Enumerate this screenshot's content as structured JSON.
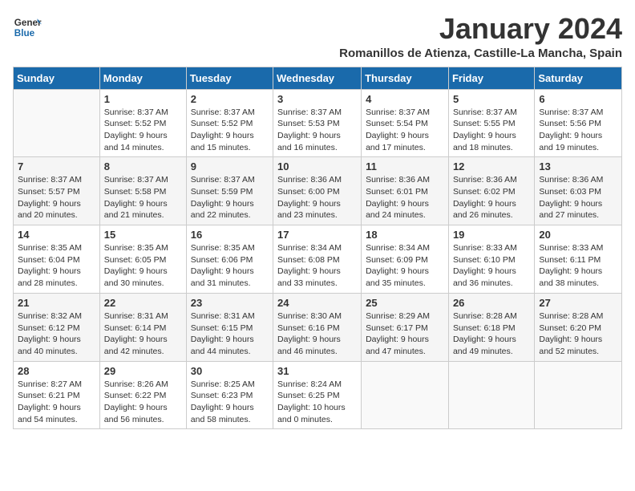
{
  "header": {
    "logo_general": "General",
    "logo_blue": "Blue",
    "month_title": "January 2024",
    "subtitle": "Romanillos de Atienza, Castille-La Mancha, Spain"
  },
  "days_of_week": [
    "Sunday",
    "Monday",
    "Tuesday",
    "Wednesday",
    "Thursday",
    "Friday",
    "Saturday"
  ],
  "weeks": [
    [
      {
        "num": "",
        "info": ""
      },
      {
        "num": "1",
        "info": "Sunrise: 8:37 AM\nSunset: 5:52 PM\nDaylight: 9 hours\nand 14 minutes."
      },
      {
        "num": "2",
        "info": "Sunrise: 8:37 AM\nSunset: 5:52 PM\nDaylight: 9 hours\nand 15 minutes."
      },
      {
        "num": "3",
        "info": "Sunrise: 8:37 AM\nSunset: 5:53 PM\nDaylight: 9 hours\nand 16 minutes."
      },
      {
        "num": "4",
        "info": "Sunrise: 8:37 AM\nSunset: 5:54 PM\nDaylight: 9 hours\nand 17 minutes."
      },
      {
        "num": "5",
        "info": "Sunrise: 8:37 AM\nSunset: 5:55 PM\nDaylight: 9 hours\nand 18 minutes."
      },
      {
        "num": "6",
        "info": "Sunrise: 8:37 AM\nSunset: 5:56 PM\nDaylight: 9 hours\nand 19 minutes."
      }
    ],
    [
      {
        "num": "7",
        "info": "Sunrise: 8:37 AM\nSunset: 5:57 PM\nDaylight: 9 hours\nand 20 minutes."
      },
      {
        "num": "8",
        "info": "Sunrise: 8:37 AM\nSunset: 5:58 PM\nDaylight: 9 hours\nand 21 minutes."
      },
      {
        "num": "9",
        "info": "Sunrise: 8:37 AM\nSunset: 5:59 PM\nDaylight: 9 hours\nand 22 minutes."
      },
      {
        "num": "10",
        "info": "Sunrise: 8:36 AM\nSunset: 6:00 PM\nDaylight: 9 hours\nand 23 minutes."
      },
      {
        "num": "11",
        "info": "Sunrise: 8:36 AM\nSunset: 6:01 PM\nDaylight: 9 hours\nand 24 minutes."
      },
      {
        "num": "12",
        "info": "Sunrise: 8:36 AM\nSunset: 6:02 PM\nDaylight: 9 hours\nand 26 minutes."
      },
      {
        "num": "13",
        "info": "Sunrise: 8:36 AM\nSunset: 6:03 PM\nDaylight: 9 hours\nand 27 minutes."
      }
    ],
    [
      {
        "num": "14",
        "info": "Sunrise: 8:35 AM\nSunset: 6:04 PM\nDaylight: 9 hours\nand 28 minutes."
      },
      {
        "num": "15",
        "info": "Sunrise: 8:35 AM\nSunset: 6:05 PM\nDaylight: 9 hours\nand 30 minutes."
      },
      {
        "num": "16",
        "info": "Sunrise: 8:35 AM\nSunset: 6:06 PM\nDaylight: 9 hours\nand 31 minutes."
      },
      {
        "num": "17",
        "info": "Sunrise: 8:34 AM\nSunset: 6:08 PM\nDaylight: 9 hours\nand 33 minutes."
      },
      {
        "num": "18",
        "info": "Sunrise: 8:34 AM\nSunset: 6:09 PM\nDaylight: 9 hours\nand 35 minutes."
      },
      {
        "num": "19",
        "info": "Sunrise: 8:33 AM\nSunset: 6:10 PM\nDaylight: 9 hours\nand 36 minutes."
      },
      {
        "num": "20",
        "info": "Sunrise: 8:33 AM\nSunset: 6:11 PM\nDaylight: 9 hours\nand 38 minutes."
      }
    ],
    [
      {
        "num": "21",
        "info": "Sunrise: 8:32 AM\nSunset: 6:12 PM\nDaylight: 9 hours\nand 40 minutes."
      },
      {
        "num": "22",
        "info": "Sunrise: 8:31 AM\nSunset: 6:14 PM\nDaylight: 9 hours\nand 42 minutes."
      },
      {
        "num": "23",
        "info": "Sunrise: 8:31 AM\nSunset: 6:15 PM\nDaylight: 9 hours\nand 44 minutes."
      },
      {
        "num": "24",
        "info": "Sunrise: 8:30 AM\nSunset: 6:16 PM\nDaylight: 9 hours\nand 46 minutes."
      },
      {
        "num": "25",
        "info": "Sunrise: 8:29 AM\nSunset: 6:17 PM\nDaylight: 9 hours\nand 47 minutes."
      },
      {
        "num": "26",
        "info": "Sunrise: 8:28 AM\nSunset: 6:18 PM\nDaylight: 9 hours\nand 49 minutes."
      },
      {
        "num": "27",
        "info": "Sunrise: 8:28 AM\nSunset: 6:20 PM\nDaylight: 9 hours\nand 52 minutes."
      }
    ],
    [
      {
        "num": "28",
        "info": "Sunrise: 8:27 AM\nSunset: 6:21 PM\nDaylight: 9 hours\nand 54 minutes."
      },
      {
        "num": "29",
        "info": "Sunrise: 8:26 AM\nSunset: 6:22 PM\nDaylight: 9 hours\nand 56 minutes."
      },
      {
        "num": "30",
        "info": "Sunrise: 8:25 AM\nSunset: 6:23 PM\nDaylight: 9 hours\nand 58 minutes."
      },
      {
        "num": "31",
        "info": "Sunrise: 8:24 AM\nSunset: 6:25 PM\nDaylight: 10 hours\nand 0 minutes."
      },
      {
        "num": "",
        "info": ""
      },
      {
        "num": "",
        "info": ""
      },
      {
        "num": "",
        "info": ""
      }
    ]
  ]
}
